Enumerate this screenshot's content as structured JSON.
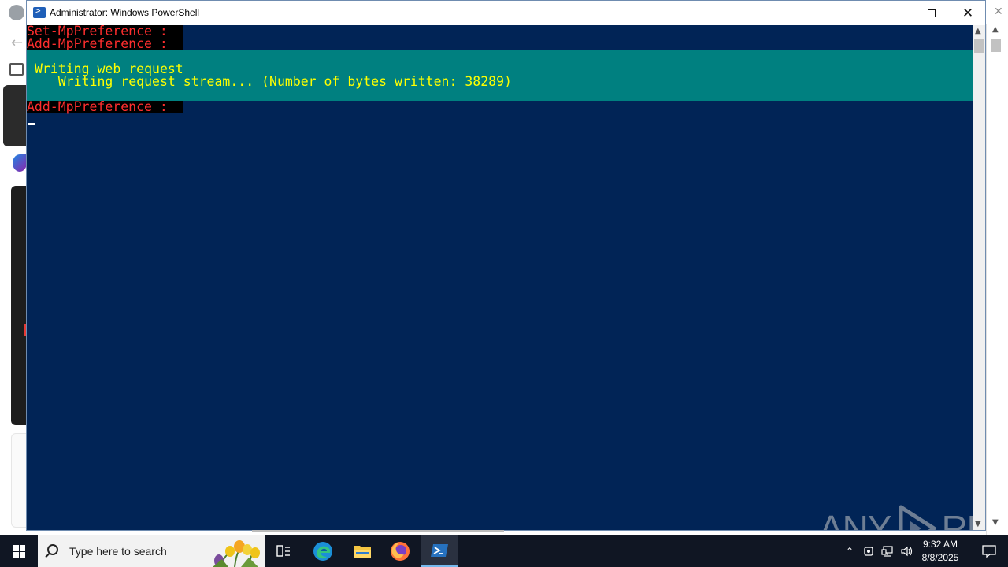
{
  "window": {
    "title": "Administrator: Windows PowerShell"
  },
  "console": {
    "lines": [
      {
        "text": "Set-MpPreference : ",
        "kind": "error"
      },
      {
        "text": "Add-MpPreference : ",
        "kind": "error"
      }
    ],
    "progress": {
      "activity": "Writing web request",
      "status": "   Writing request stream... (Number of bytes written: 38289)"
    },
    "after_lines": [
      {
        "text": "Add-MpPreference : ",
        "kind": "error"
      }
    ],
    "colors": {
      "background": "#012456",
      "error_fg": "#ff2e2e",
      "error_bg": "#000000",
      "progress_bg": "#008080",
      "progress_fg": "#ffff00"
    }
  },
  "watermark": {
    "left": "ANY",
    "right": "RUN"
  },
  "taskbar": {
    "search_placeholder": "Type here to search",
    "clock_time": "9:32 AM",
    "clock_date": "8/8/2025",
    "pinned": [
      "task-view",
      "edge",
      "file-explorer",
      "firefox",
      "powershell"
    ],
    "active": "powershell"
  }
}
